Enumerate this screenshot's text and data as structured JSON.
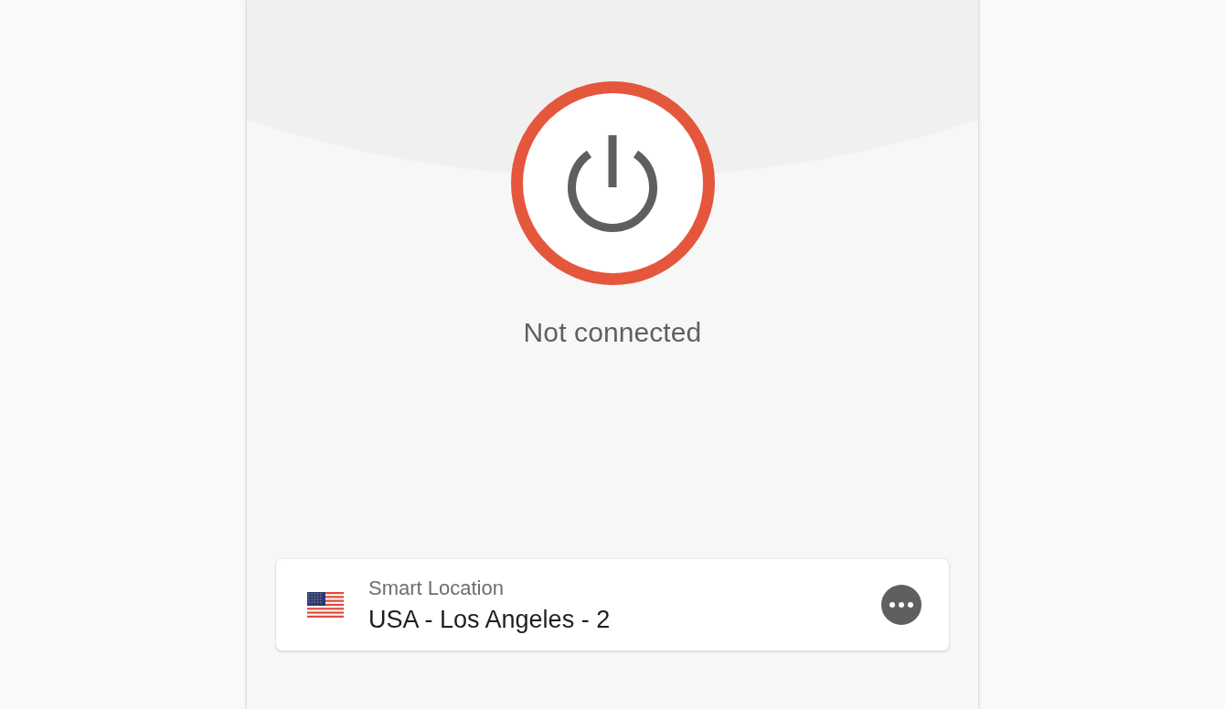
{
  "connection": {
    "status": "Not connected",
    "connected": false
  },
  "location": {
    "label": "Smart Location",
    "name": "USA - Los Angeles - 2"
  }
}
